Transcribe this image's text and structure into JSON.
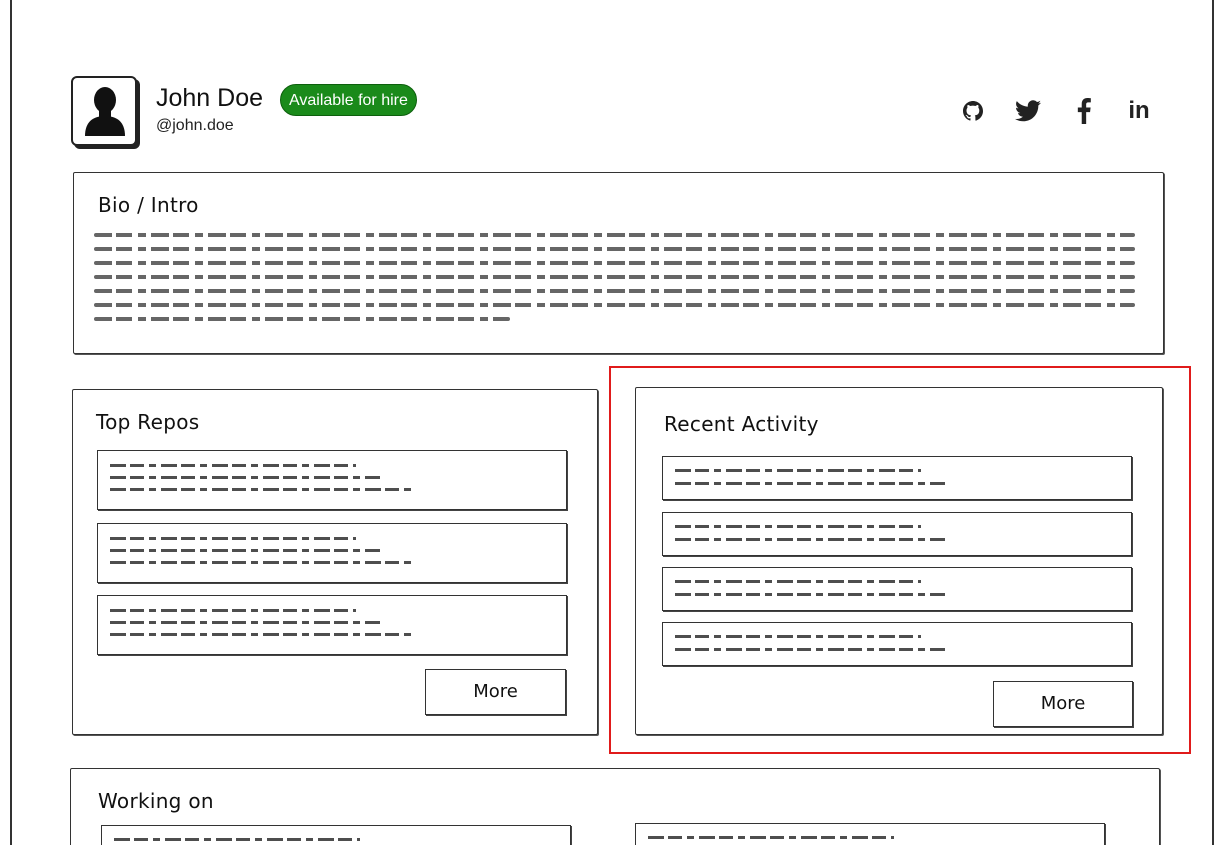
{
  "profile": {
    "name": "John Doe",
    "handle": "@john.doe",
    "badge": "Available for hire",
    "badge_color": "#1a8a1a"
  },
  "social": [
    {
      "icon": "github-icon"
    },
    {
      "icon": "twitter-icon"
    },
    {
      "icon": "facebook-icon"
    },
    {
      "icon": "linkedin-icon",
      "label": "in"
    }
  ],
  "bio": {
    "title": "Bio / Intro"
  },
  "top_repos": {
    "title": "Top Repos",
    "more_label": "More"
  },
  "recent_activity": {
    "title": "Recent Activity",
    "more_label": "More"
  },
  "working_on": {
    "title": "Working on"
  },
  "colors": {
    "highlight": "#e01b1b",
    "ink": "#333333"
  }
}
